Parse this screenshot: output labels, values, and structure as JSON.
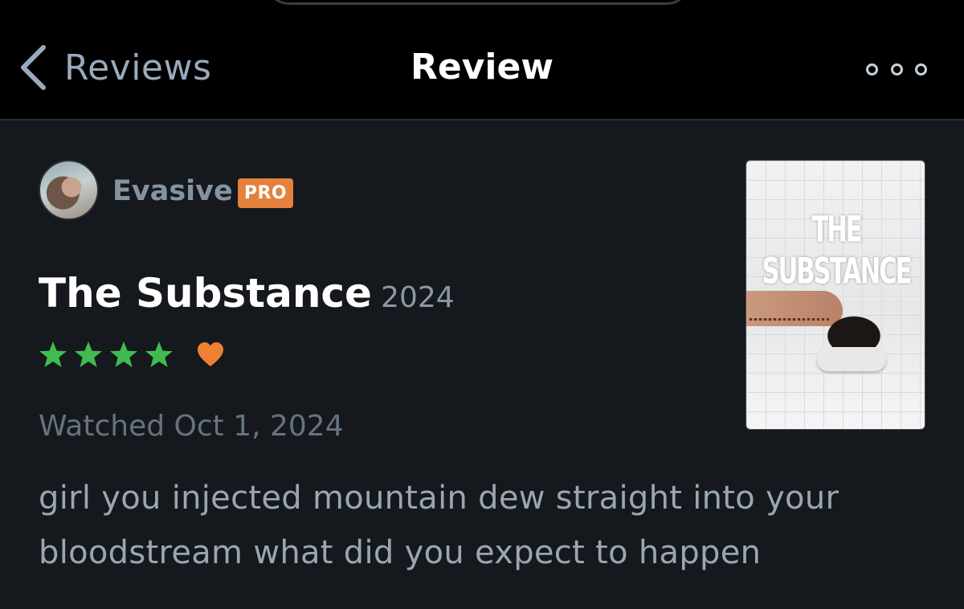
{
  "header": {
    "back_label": "Reviews",
    "title": "Review",
    "icons": {
      "back": "chevron-left-icon",
      "more": "more-options-icon"
    }
  },
  "review": {
    "username": "Evasive",
    "badge": "PRO",
    "film_title": "The Substance",
    "film_year": "2024",
    "rating_stars": 4,
    "liked": true,
    "watched_date": "Watched Oct 1, 2024",
    "body": "girl you injected mountain dew straight into your bloodstream what did you expect to happen",
    "poster_title": "THE SUBSTANCE"
  },
  "colors": {
    "background": "#15181c",
    "header": "#000000",
    "star": "#40bc4f",
    "heart": "#ee8033",
    "badge": "#e4813d",
    "muted_text": "#99a6b3"
  }
}
